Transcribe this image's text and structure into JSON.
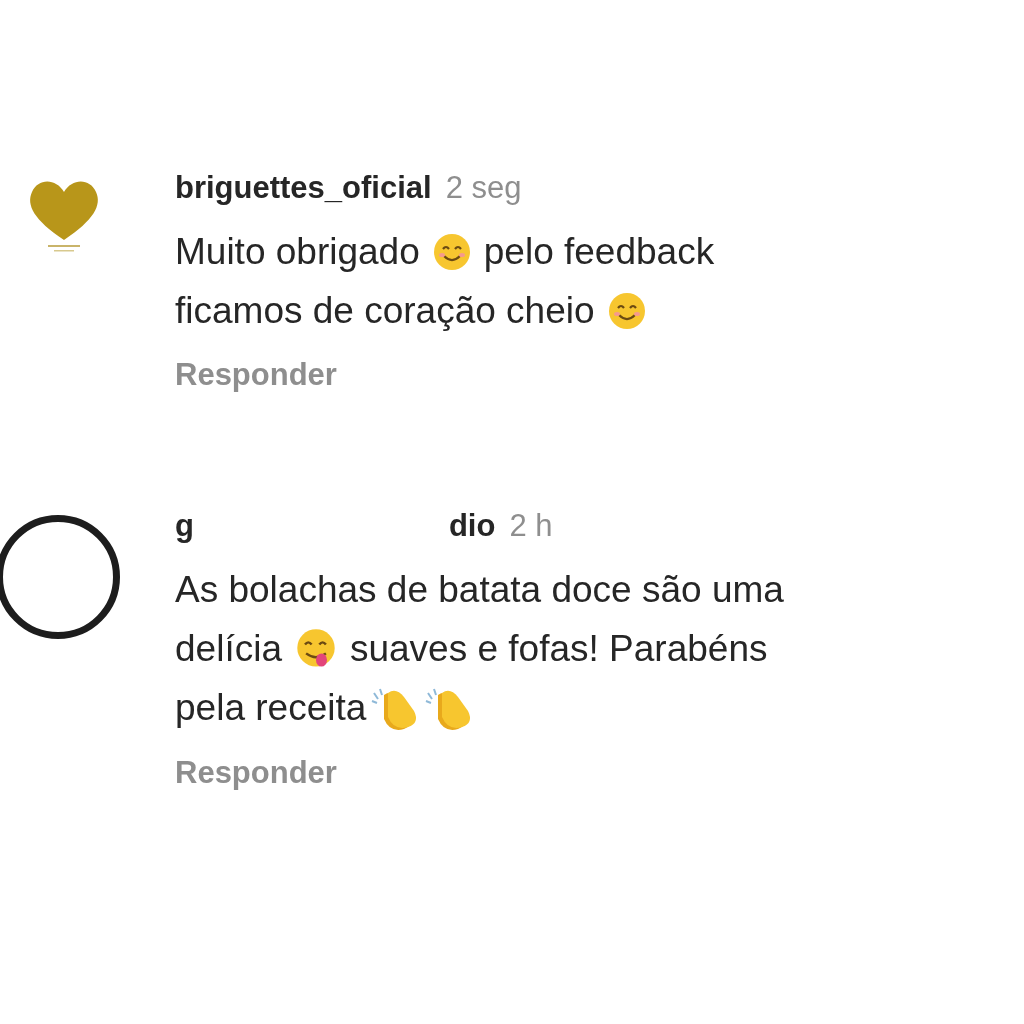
{
  "comments": [
    {
      "avatar": {
        "kind": "logo"
      },
      "username_parts": [
        "briguettes_oficial"
      ],
      "time": "2 seg",
      "lines": [
        [
          {
            "kind": "text",
            "text": "Muito obrigado"
          },
          {
            "kind": "smile"
          },
          {
            "kind": "text",
            "text": "pelo feedback"
          }
        ],
        [
          {
            "kind": "text",
            "text": "ficamos de coração cheio"
          },
          {
            "kind": "smile"
          }
        ]
      ],
      "reply": "Responder"
    },
    {
      "avatar": {
        "kind": "ring"
      },
      "username_parts": [
        "g",
        "dio"
      ],
      "time": "2 h",
      "lines": [
        [
          {
            "kind": "text",
            "text": "As bolachas de batata doce são uma"
          }
        ],
        [
          {
            "kind": "text",
            "text": "delícia"
          },
          {
            "kind": "yum"
          },
          {
            "kind": "text",
            "text": "suaves e fofas! Parabéns"
          }
        ],
        [
          {
            "kind": "text",
            "text": "pela receita"
          },
          {
            "kind": "clap"
          },
          {
            "kind": "clap"
          }
        ]
      ],
      "reply": "Responder"
    }
  ]
}
